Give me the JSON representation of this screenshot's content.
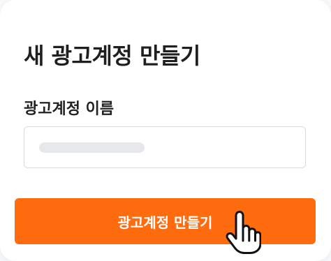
{
  "dialog": {
    "title": "새 광고계정 만들기"
  },
  "form": {
    "account_name_label": "광고계정 이름",
    "account_name_value": "",
    "account_name_placeholder": ""
  },
  "actions": {
    "create_button_label": "광고계정 만들기"
  },
  "icons": {
    "cursor": "hand-pointer-icon"
  },
  "colors": {
    "primary": "#ff6b0f",
    "title_text": "#1f1f1f",
    "input_border": "#d7dbe0",
    "placeholder_bar": "#e6e8ec",
    "background": "#ffffff"
  }
}
